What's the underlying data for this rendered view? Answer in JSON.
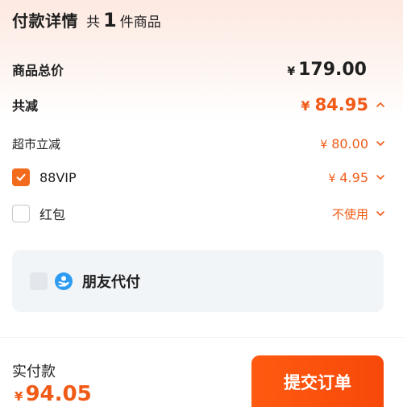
{
  "header": {
    "title": "付款详情",
    "count_prefix": "共",
    "count": "1",
    "count_suffix": "件商品"
  },
  "summary": {
    "total_label": "商品总价",
    "total_symbol": "¥",
    "total_value": "179.00",
    "discount_label": "共减",
    "discount_symbol": "¥",
    "discount_value": "84.95"
  },
  "discounts": {
    "supermarket": {
      "label": "超市立减",
      "symbol": "¥",
      "value": "80.00"
    },
    "vip": {
      "label": "88VIP",
      "symbol": "¥",
      "value": "4.95",
      "checked": true
    },
    "redpacket": {
      "label": "红包",
      "value": "不使用",
      "checked": false
    }
  },
  "friend_pay": {
    "label": "朋友代付"
  },
  "footer": {
    "pay_label": "实付款",
    "pay_symbol": "¥",
    "pay_value": "94.05",
    "submit_label": "提交订单"
  },
  "colors": {
    "accent": "#f05a16",
    "button": "#ff5a10",
    "panel": "#f2f5f8",
    "friend_icon": "#2e9cf2"
  },
  "icons": {
    "chevron_up": "chevron-up-icon",
    "chevron_down": "chevron-down-icon",
    "check": "check-icon",
    "friend": "hand-coin-icon"
  }
}
